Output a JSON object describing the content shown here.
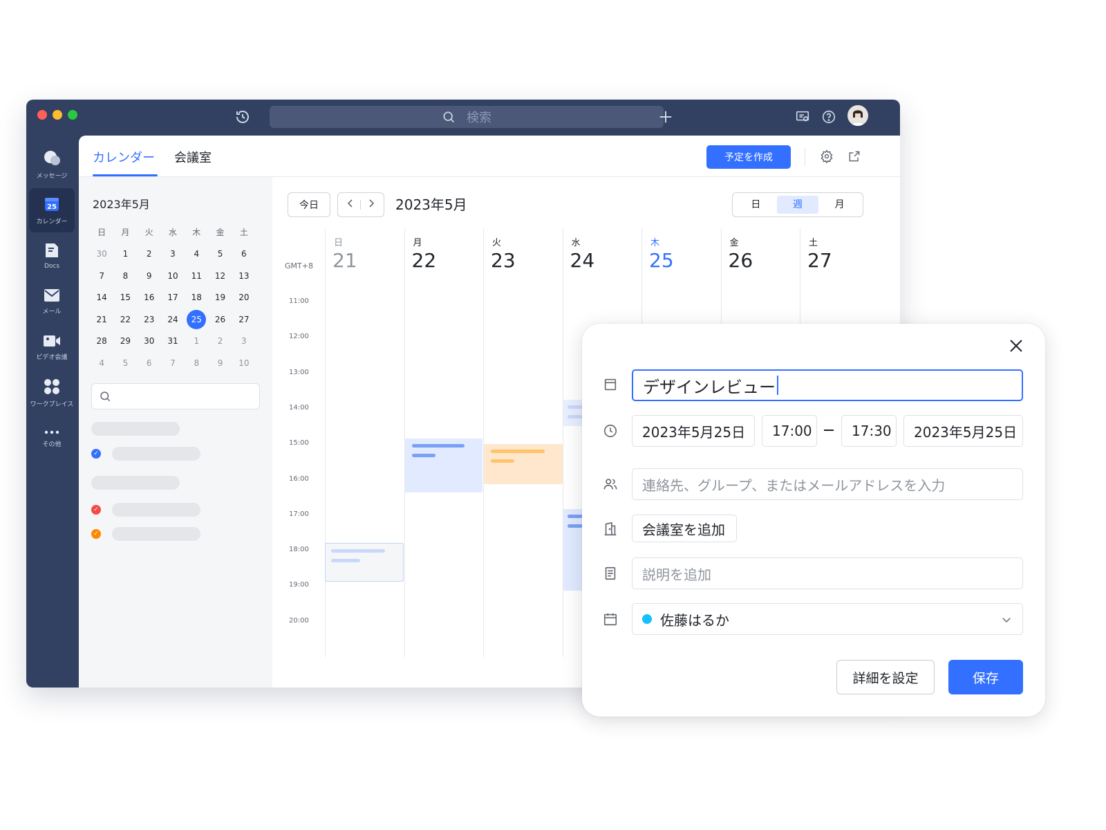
{
  "window": {
    "search_placeholder": "検索",
    "traffic_lights": [
      "#ff5f57",
      "#febc2e",
      "#28c840"
    ]
  },
  "rail": {
    "items": [
      {
        "label": "メッセージ",
        "icon": "chat-bubble-icon"
      },
      {
        "label": "カレンダー",
        "icon": "calendar-icon",
        "icon_text": "25",
        "active": true
      },
      {
        "label": "Docs",
        "icon": "docs-icon"
      },
      {
        "label": "メール",
        "icon": "mail-icon"
      },
      {
        "label": "ビデオ会議",
        "icon": "video-camera-icon"
      },
      {
        "label": "ワークプレイス",
        "icon": "apps-grid-icon"
      },
      {
        "label": "その他",
        "icon": "more-dots-icon"
      }
    ]
  },
  "tabs": {
    "calendar": "カレンダー",
    "meeting_room": "会議室"
  },
  "toolbar": {
    "create_event": "予定を作成"
  },
  "mini_calendar": {
    "title": "2023年5月",
    "weekdays": [
      "日",
      "月",
      "火",
      "水",
      "木",
      "金",
      "土"
    ],
    "weeks": [
      [
        "30",
        "1",
        "2",
        "3",
        "4",
        "5",
        "6"
      ],
      [
        "7",
        "8",
        "9",
        "10",
        "11",
        "12",
        "13"
      ],
      [
        "14",
        "15",
        "16",
        "17",
        "18",
        "19",
        "20"
      ],
      [
        "21",
        "22",
        "23",
        "24",
        "25",
        "26",
        "27"
      ],
      [
        "28",
        "29",
        "30",
        "31",
        "1",
        "2",
        "3"
      ],
      [
        "4",
        "5",
        "6",
        "7",
        "8",
        "9",
        "10"
      ]
    ],
    "today": "25"
  },
  "calendar_view": {
    "today_button": "今日",
    "title": "2023年5月",
    "views": [
      "日",
      "週",
      "月"
    ],
    "active_view": "週",
    "timezone": "GMT+8",
    "hours": [
      "11:00",
      "12:00",
      "13:00",
      "14:00",
      "15:00",
      "16:00",
      "17:00",
      "18:00",
      "19:00",
      "20:00"
    ],
    "days": [
      {
        "weekday": "日",
        "date": "21"
      },
      {
        "weekday": "月",
        "date": "22"
      },
      {
        "weekday": "火",
        "date": "23"
      },
      {
        "weekday": "水",
        "date": "24"
      },
      {
        "weekday": "木",
        "date": "25",
        "today": true
      },
      {
        "weekday": "金",
        "date": "26"
      },
      {
        "weekday": "土",
        "date": "27"
      }
    ],
    "colors": {
      "accent": "#3370ff",
      "muted": "#8f959e",
      "event_blue": "#e1eaff",
      "event_orange": "#fee7cd"
    }
  },
  "dialog": {
    "title_value": "デザインレビュー",
    "start_date": "2023年5月25日",
    "start_time": "17:00",
    "end_time": "17:30",
    "end_date": "2023年5月25日",
    "guests_placeholder": "連絡先、グループ、またはメールアドレスを入力",
    "add_room": "会議室を追加",
    "description_placeholder": "説明を追加",
    "calendar_owner": "佐藤はるか",
    "owner_color": "#14c0ff",
    "details_button": "詳細を設定",
    "save_button": "保存"
  }
}
